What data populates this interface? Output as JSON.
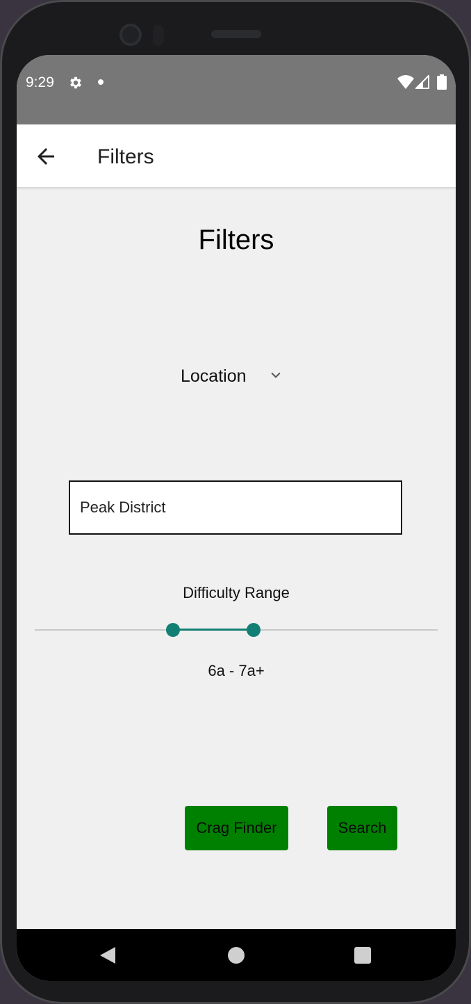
{
  "status_bar": {
    "time": "9:29"
  },
  "app_bar": {
    "title": "Filters"
  },
  "main": {
    "heading": "Filters",
    "location_dropdown": {
      "selected": "Location"
    },
    "location_input": {
      "value": "Peak District"
    },
    "difficulty": {
      "label": "Difficulty Range",
      "value_text": "6a - 7a+",
      "range_low_fraction": 0.343,
      "range_high_fraction": 0.543
    },
    "buttons": {
      "crag_finder": "Crag Finder",
      "search": "Search"
    }
  },
  "colors": {
    "accent": "#127f74",
    "button_green": "#008000",
    "status_bar": "#777777",
    "background": "#f0f0f0"
  },
  "icons": {
    "back": "arrow-left-icon",
    "settings": "gear-icon",
    "dropdown": "chevron-down-icon",
    "wifi": "wifi-icon",
    "signal": "signal-icon",
    "battery": "battery-icon"
  }
}
